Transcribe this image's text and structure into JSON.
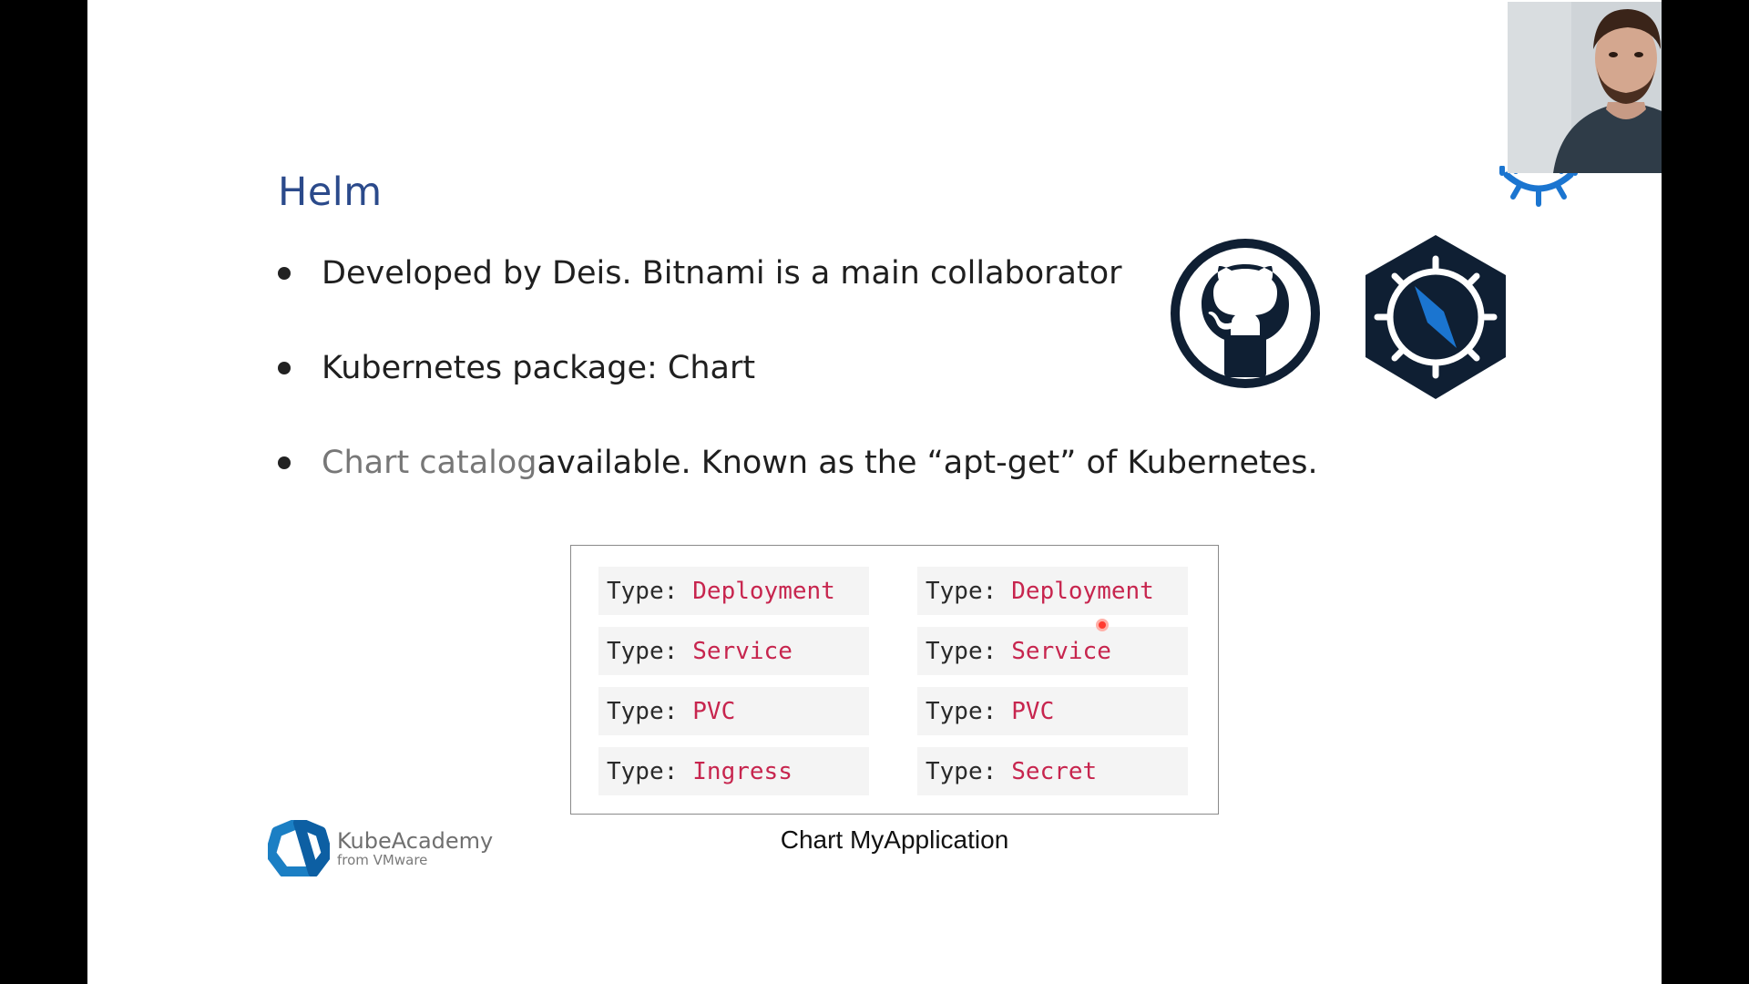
{
  "slide": {
    "title": "Helm",
    "bullets": [
      {
        "prefix": "",
        "highlight": "",
        "text": "Developed by Deis. Bitnami is a main collaborator"
      },
      {
        "prefix": "",
        "highlight": "",
        "text": "Kubernetes package: Chart"
      },
      {
        "prefix": "",
        "highlight": "Chart catalog",
        "text": " available. Known as the “apt-get” of Kubernetes."
      }
    ]
  },
  "chart_box": {
    "caption": "Chart MyApplication",
    "key_label": "Type:",
    "left_column": [
      "Deployment",
      "Service",
      "PVC",
      "Ingress"
    ],
    "right_column": [
      "Deployment",
      "Service",
      "PVC",
      "Secret"
    ]
  },
  "branding": {
    "name": "KubeAcademy",
    "sub": "from VMware"
  },
  "colors": {
    "title": "#2b4a8b",
    "value_red": "#c7254e",
    "helm_hex": "#0f1f33",
    "helm_needle": "#1b75d0",
    "brand_blue": "#1b7fc4"
  },
  "icons": {
    "github": "github-octocat-icon",
    "helm": "helm-compass-icon",
    "kubeacademy": "kubeacademy-heptagon-icon"
  }
}
